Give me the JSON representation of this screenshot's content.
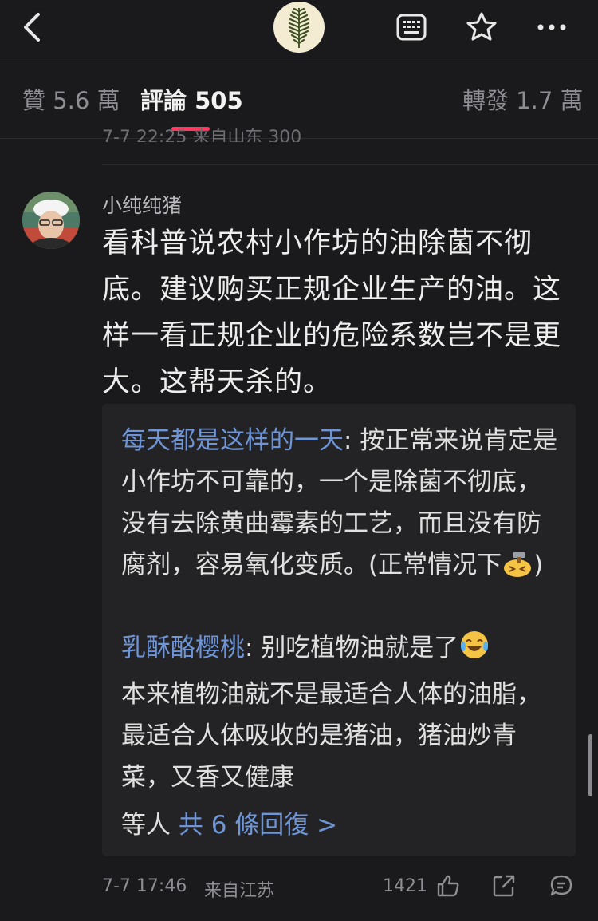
{
  "header": {
    "icons": [
      "back-chevron-icon",
      "fern-logo-icon",
      "keyboard-icon",
      "star-icon",
      "more-icon"
    ]
  },
  "tabs": {
    "likes": "贊 5.6 萬",
    "comments": "評論 505",
    "reposts": "轉發 1.7 萬"
  },
  "previous_comment": {
    "meta": "7-7 22:25  来自山东                                  300"
  },
  "comment": {
    "author": "小纯纯猪",
    "text": "看科普说农村小作坊的油除菌不彻底。建议购买正规企业生产的油。这样一看正规企业的危险系数岂不是更大。这帮天杀的。",
    "replies": [
      {
        "author": "每天都是这样的一天",
        "sep": ": ",
        "text": "按正常来说肯定是小作坊不可靠的，一个是除菌不彻底，没有去除黄曲霉素的工艺，而且没有防腐剂，容易氧化变质。(正常情况下",
        "text_end": ")",
        "emoji": "hammer-face-emoji"
      },
      {
        "author": "乳酥酪樱桃",
        "sep": ": ",
        "text": "别吃植物油就是了",
        "text_after": "本来植物油就不是最适合人体的油脂，最适合人体吸收的是猪油，猪油炒青菜，又香又健康",
        "emoji": "laughing-tears-emoji"
      }
    ],
    "more_prefix": "等人 ",
    "more_link": "共 6 條回復 >",
    "time": "7-7 17:46",
    "location": "来自江苏",
    "like_count": "1421",
    "footer_icons": [
      "thumbs-up-icon",
      "share-icon",
      "comment-icon"
    ]
  },
  "colors": {
    "accent": "#ff3a5e",
    "link": "#6e95d8",
    "background": "#1a1a1c"
  }
}
